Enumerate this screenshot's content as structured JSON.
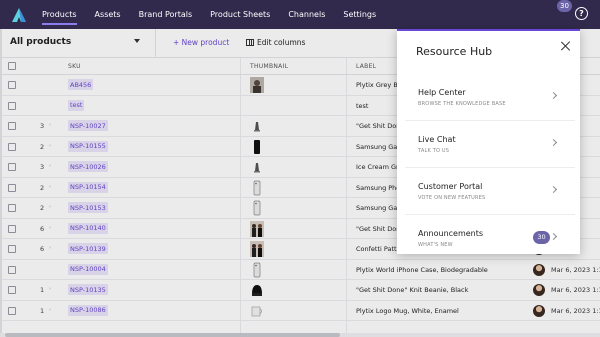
{
  "nav": {
    "items": [
      "Products",
      "Assets",
      "Brand Portals",
      "Product Sheets",
      "Channels",
      "Settings"
    ],
    "badge": "30",
    "help": "?"
  },
  "toolbar": {
    "view": "All products",
    "new_product": "+ New product",
    "edit_columns": "Edit columns"
  },
  "table": {
    "headers": [
      "SKU",
      "THUMBNAIL",
      "LABEL"
    ],
    "rows": [
      {
        "count": "",
        "sku": "AB456",
        "label": "Plytix Grey Ba",
        "date": "23 2:4",
        "thumb": "photo"
      },
      {
        "count": "",
        "sku": "test",
        "label": "test",
        "date": "23 1:1",
        "thumb": "none"
      },
      {
        "count": "3",
        "sku": "NSP-10027",
        "label": "\"Get Shit Done",
        "date": "23 1:1",
        "thumb": "stand"
      },
      {
        "count": "2",
        "sku": "NSP-10155",
        "label": "Samsung Gala",
        "date": "23 1:1",
        "thumb": "phone-black"
      },
      {
        "count": "3",
        "sku": "NSP-10026",
        "label": "Ice Cream Gra",
        "date": "23 1:1",
        "thumb": "stand"
      },
      {
        "count": "2",
        "sku": "NSP-10154",
        "label": "Samsung Phon",
        "date": "23 1:1",
        "thumb": "case"
      },
      {
        "count": "2",
        "sku": "NSP-10153",
        "label": "Samsung Gala",
        "date": "23 1:1",
        "thumb": "case"
      },
      {
        "count": "6",
        "sku": "NSP-10140",
        "label": "\"Get Shit Done",
        "date": "23 1:1",
        "thumb": "people"
      },
      {
        "count": "6",
        "sku": "NSP-10139",
        "label": "Confetti Pattern Sports Bra, Black",
        "date": "23 1:1",
        "thumb": "people"
      },
      {
        "count": "",
        "sku": "NSP-10004",
        "label": "Plytix World iPhone Case, Biodegradable",
        "date": "Mar 6, 2023 1:12",
        "thumb": "case"
      },
      {
        "count": "1",
        "sku": "NSP-10135",
        "label": "\"Get Shit Done\" Knit Beanie, Black",
        "date": "Mar 6, 2023 1:12",
        "thumb": "beanie"
      },
      {
        "count": "1",
        "sku": "NSP-10086",
        "label": "Plytix Logo Mug, White, Enamel",
        "date": "Mar 6, 2023 1:12",
        "thumb": "mug"
      }
    ]
  },
  "hub": {
    "title": "Resource Hub",
    "items": [
      {
        "name": "Help Center",
        "sub": "BROWSE THE KNOWLEDGE BASE"
      },
      {
        "name": "Live Chat",
        "sub": "TALK TO US"
      },
      {
        "name": "Customer Portal",
        "sub": "VOTE ON NEW FEATURES"
      },
      {
        "name": "Announcements",
        "sub": "WHAT'S NEW",
        "badge": "30"
      }
    ]
  },
  "colors": {
    "nav_bg": "#312a4c",
    "accent": "#6a48d7",
    "sku_bg": "#ebe5fa",
    "badge": "#6b64a8"
  },
  "icons": [
    "plytix-logo-icon",
    "help-icon",
    "caret-down-icon",
    "columns-icon",
    "close-icon",
    "chevron-right-icon"
  ]
}
